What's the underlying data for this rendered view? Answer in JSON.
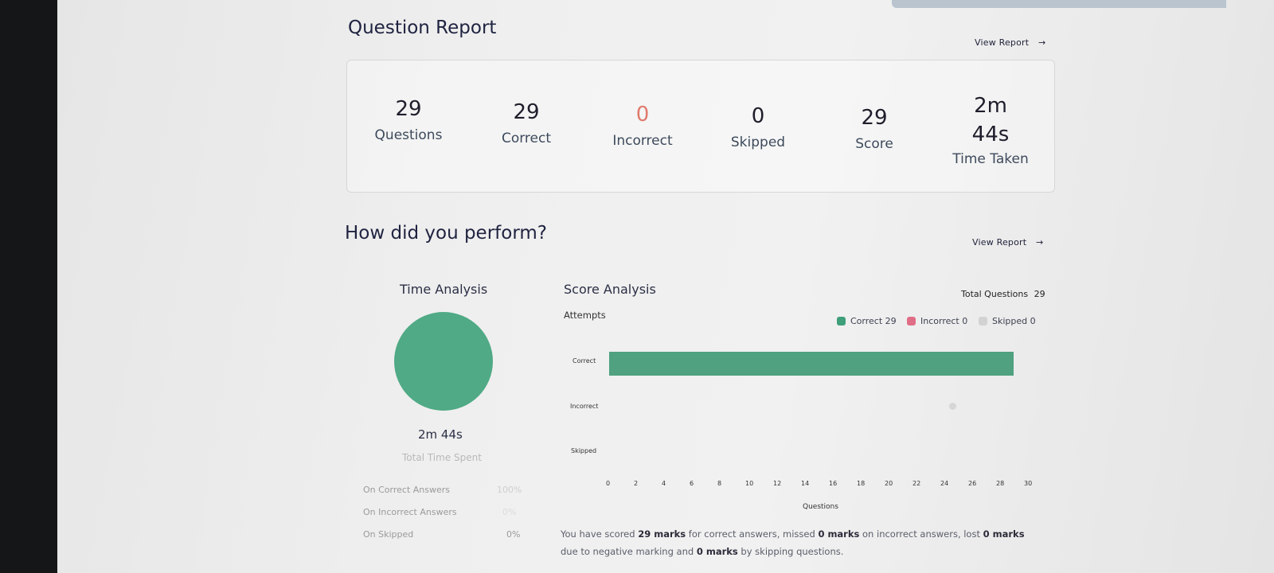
{
  "question_report": {
    "title": "Question Report",
    "view_report": "View Report",
    "stats": [
      {
        "value": "29",
        "label": "Questions"
      },
      {
        "value": "29",
        "label": "Correct"
      },
      {
        "value": "0",
        "label": "Incorrect"
      },
      {
        "value": "0",
        "label": "Skipped"
      },
      {
        "value": "29",
        "label": "Score"
      },
      {
        "value_line1": "2m",
        "value_line2": "44s",
        "label": "Time Taken"
      }
    ]
  },
  "performance": {
    "title": "How did you perform?",
    "view_report": "View Report",
    "time_analysis": {
      "title": "Time Analysis",
      "total_time": "2m 44s",
      "total_time_label": "Total Time Spent",
      "rows": [
        {
          "label": "On Correct Answers",
          "value": "100%"
        },
        {
          "label": "On Incorrect Answers",
          "value": "0%"
        },
        {
          "label": "On Skipped",
          "value": "0%"
        }
      ]
    },
    "score_analysis": {
      "title": "Score Analysis",
      "total_questions_label": "Total Questions",
      "total_questions_value": "29",
      "attempts_label": "Attempts",
      "legend": [
        {
          "label": "Correct 29",
          "color": "#3f9f7b"
        },
        {
          "label": "Incorrect 0",
          "color": "#e06d86"
        },
        {
          "label": "Skipped 0",
          "color": "#d2d2d2"
        }
      ],
      "note": {
        "p1": "You have scored",
        "b1": "29 marks",
        "p2": "for correct answers, missed",
        "b2": "0 marks",
        "p3": "on incorrect answers, lost",
        "b3": "0 marks",
        "p4": "due to negative marking and",
        "b4": "0 marks",
        "p5": "by skipping questions."
      }
    }
  },
  "chart_data": {
    "type": "bar",
    "orientation": "horizontal",
    "categories": [
      "Correct",
      "Incorrect",
      "Skipped"
    ],
    "values": [
      29,
      0,
      0
    ],
    "xlabel": "Questions",
    "x_ticks": [
      "0",
      "2",
      "4",
      "6",
      "8",
      "10",
      "12",
      "14",
      "16",
      "18",
      "20",
      "22",
      "24",
      "26",
      "28",
      "30"
    ],
    "xlim": [
      0,
      30
    ],
    "bar_color": "#4fa17f"
  }
}
